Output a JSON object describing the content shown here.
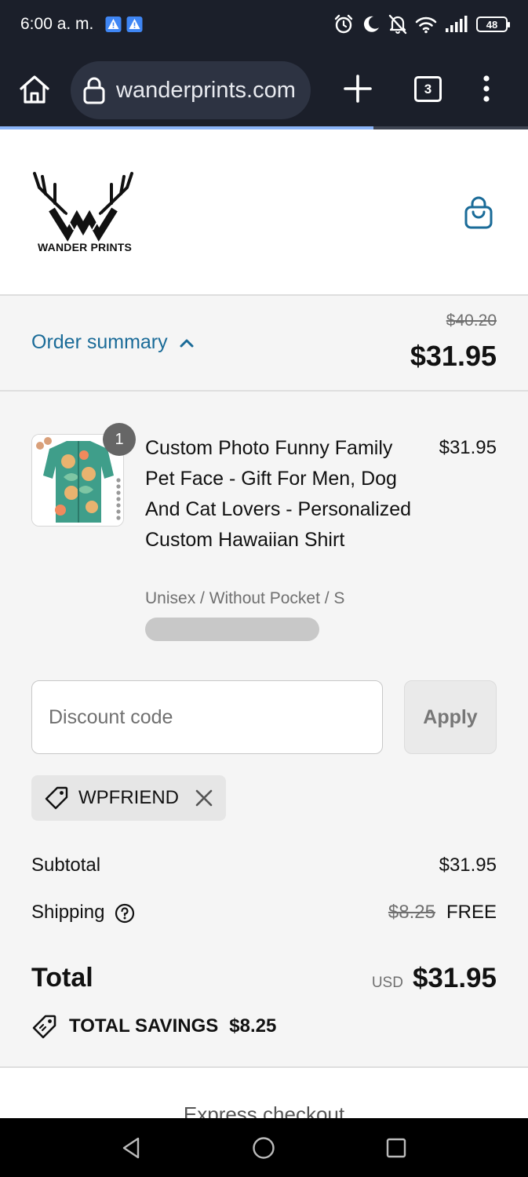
{
  "status_bar": {
    "time": "6:00 a. m.",
    "battery": "48",
    "icons": [
      "alert-icon",
      "alert-icon",
      "alarm-icon",
      "moon-icon",
      "notifications-off-icon",
      "wifi-icon",
      "signal-icon",
      "battery-icon"
    ]
  },
  "browser": {
    "url": "wanderprints.com",
    "tab_count": "3",
    "load_progress": 0.707
  },
  "site": {
    "logo_text": "WANDER PRINTS"
  },
  "summary": {
    "toggle_label": "Order summary",
    "original_total": "$40.20",
    "total": "$31.95"
  },
  "product": {
    "quantity": "1",
    "name": "Custom Photo Funny Family Pet Face - Gift For Men, Dog And Cat Lovers - Personalized Custom Hawaiian Shirt",
    "price": "$31.95",
    "variant": "Unisex / Without Pocket / S"
  },
  "discount": {
    "placeholder": "Discount code",
    "apply_label": "Apply",
    "applied_code": "WPFRIEND"
  },
  "totals": {
    "subtotal_label": "Subtotal",
    "subtotal_value": "$31.95",
    "shipping_label": "Shipping",
    "shipping_original": "$8.25",
    "shipping_value": "FREE",
    "total_label": "Total",
    "currency": "USD",
    "total_value": "$31.95",
    "savings_label": "TOTAL SAVINGS",
    "savings_value": "$8.25"
  },
  "express": {
    "title": "Express checkout"
  },
  "colors": {
    "accent": "#1a6b98",
    "browser_chrome": "#1b1f2a",
    "page_background": "#f5f5f5"
  }
}
